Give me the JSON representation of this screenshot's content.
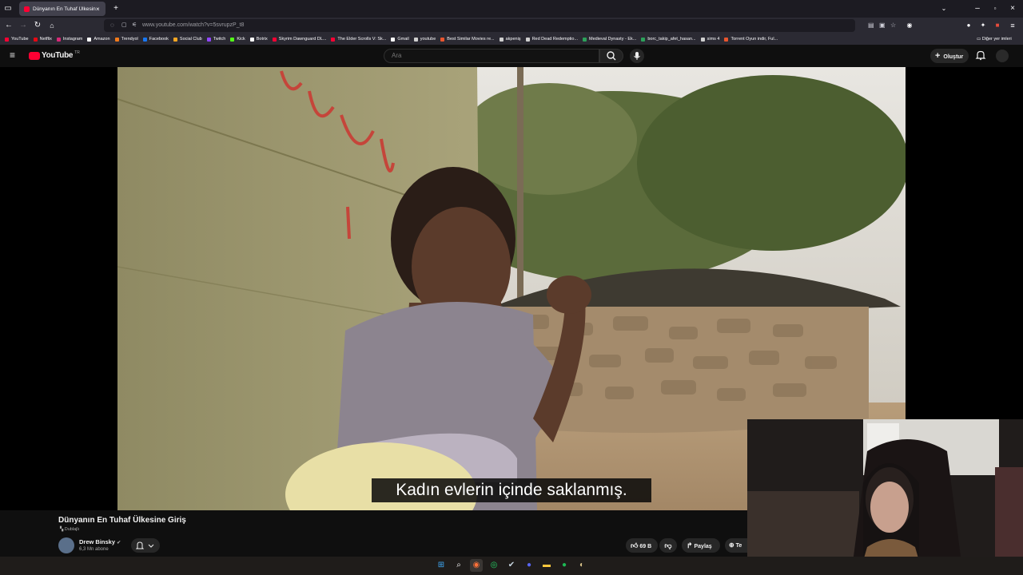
{
  "browser": {
    "tab_title": "Dünyanın En Tuhaf Ülkesine Giriş",
    "url": "www.youtube.com/watch?v=5svrupzP_t8",
    "bookmarks": [
      {
        "label": "YouTube",
        "color": "#ff0033"
      },
      {
        "label": "Netflix",
        "color": "#e50914"
      },
      {
        "label": "Instagram",
        "color": "#d62976"
      },
      {
        "label": "Amazon",
        "color": "#ffffff"
      },
      {
        "label": "Trendyol",
        "color": "#f27a1a"
      },
      {
        "label": "Facebook",
        "color": "#1877f2"
      },
      {
        "label": "Social Club",
        "color": "#f5a623"
      },
      {
        "label": "Twitch",
        "color": "#9146ff"
      },
      {
        "label": "Kick",
        "color": "#53fc18"
      },
      {
        "label": "Botrix",
        "color": "#ffffff"
      },
      {
        "label": "Skyrim Dawnguard DL...",
        "color": "#ff0033"
      },
      {
        "label": "The Elder Scrolls V: Sk...",
        "color": "#ff0033"
      },
      {
        "label": "Gmail",
        "color": "#ffffff"
      },
      {
        "label": "youtube",
        "color": "#cfcfcf"
      },
      {
        "label": "Best Similar Movies re...",
        "color": "#e8552e"
      },
      {
        "label": "akpeniş",
        "color": "#cfcfcf"
      },
      {
        "label": "Red Dead Redemptio...",
        "color": "#cfcfcf"
      },
      {
        "label": "Medieval Dynasty - Ek...",
        "color": "#2ca05a"
      },
      {
        "label": "borc_takip_afet_hasan...",
        "color": "#2ca05a"
      },
      {
        "label": "sims 4",
        "color": "#cfcfcf"
      },
      {
        "label": "Torrent Oyun indir, Ful...",
        "color": "#e8552e"
      }
    ],
    "other_bookmarks": "Diğer yer imleri"
  },
  "youtube": {
    "logo": "YouTube",
    "region": "TR",
    "search_placeholder": "Ara",
    "create_label": "Oluştur",
    "video_title": "Dünyanın En Tuhaf Ülkesine Giriş",
    "dub_label": "Dublajlı",
    "channel": "Drew Binsky",
    "subscribers": "6,3 Mn abone",
    "likes": "69 B",
    "share_label": "Paylaş",
    "thanks_label": "Te",
    "subtitle": "Kadın evlerin içinde saklanmış."
  },
  "colors": {
    "accent": "#ff0033",
    "background": "#0f0f0f"
  }
}
